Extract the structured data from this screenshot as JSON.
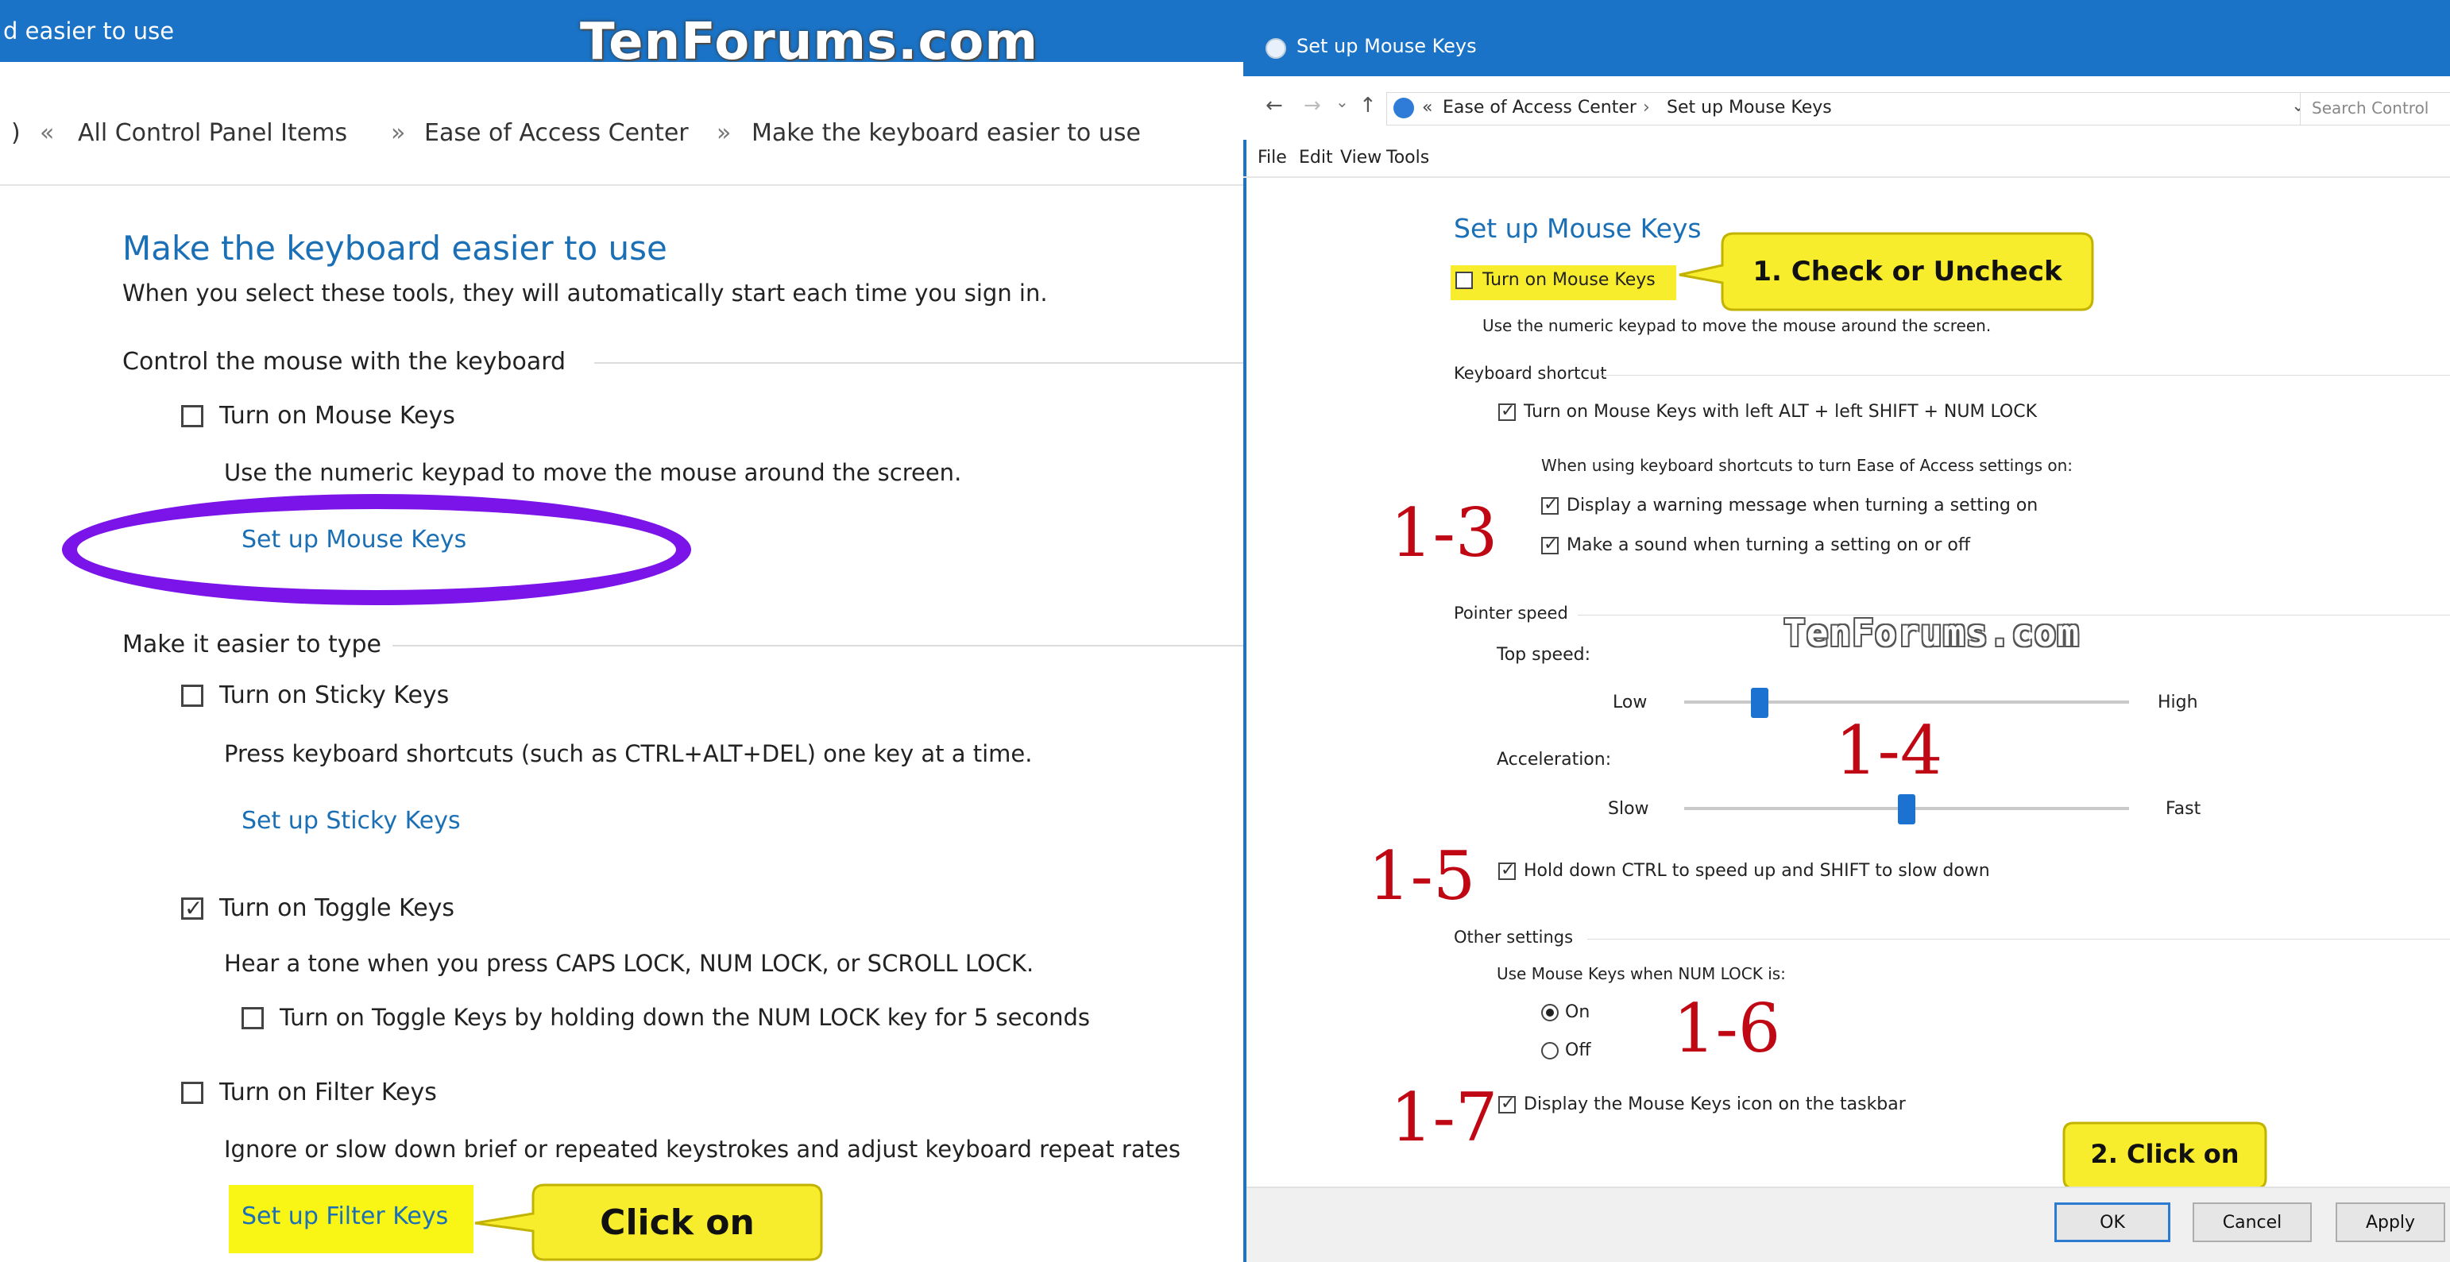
{
  "left_window": {
    "title_fragment": "d easier to use",
    "watermark": "TenForums.com",
    "breadcrumb": {
      "back_glyph": ")",
      "sep0": "«",
      "item1": "All Control Panel Items",
      "sep": "»",
      "item2": "Ease of Access Center",
      "item3": "Make the keyboard easier to use"
    },
    "heading": "Make the keyboard easier to use",
    "subheading": "When you select these tools, they will automatically start each time you sign in.",
    "section_mouse": "Control the mouse with the keyboard",
    "mouse_keys_label": "Turn on Mouse Keys",
    "mouse_keys_checked": false,
    "mouse_keys_desc": "Use the numeric keypad to move the mouse around the screen.",
    "setup_mouse_keys_link": "Set up Mouse Keys",
    "section_type": "Make it easier to type",
    "sticky_label": "Turn on Sticky Keys",
    "sticky_checked": false,
    "sticky_desc": "Press keyboard shortcuts (such as CTRL+ALT+DEL) one key at a time.",
    "setup_sticky_link": "Set up Sticky Keys",
    "toggle_label": "Turn on Toggle Keys",
    "toggle_checked": true,
    "toggle_desc": "Hear a tone when you press CAPS LOCK, NUM LOCK, or SCROLL LOCK.",
    "toggle_hold_label": "Turn on Toggle Keys by holding down the NUM LOCK key for 5 seconds",
    "toggle_hold_checked": false,
    "filter_label": "Turn on Filter Keys",
    "filter_checked": false,
    "filter_desc": "Ignore or slow down brief or repeated keystrokes and adjust keyboard repeat rates",
    "setup_filter_link": "Set up Filter Keys",
    "callout_click_on": "Click on",
    "highlight_color": "#f9f515",
    "ellipse_color": "#7a14e8"
  },
  "dialog": {
    "title": "Set up Mouse Keys",
    "address": {
      "back": "←",
      "forward": "→",
      "recent": "⌄",
      "up": "↑",
      "chev": "«",
      "crumb1": "Ease of Access Center",
      "sep": "›",
      "crumb2": "Set up Mouse Keys",
      "dropdown": "⌄",
      "refresh": "↻",
      "search_placeholder": "Search Control"
    },
    "menu": [
      "File",
      "Edit",
      "View",
      "Tools"
    ],
    "heading": "Set up Mouse Keys",
    "turn_on_label": "Turn on Mouse Keys",
    "turn_on_checked": false,
    "turn_on_desc": "Use the numeric keypad to move the mouse around the screen.",
    "section_shortcut": "Keyboard shortcut",
    "shortcut_label": "Turn on Mouse Keys with left ALT + left SHIFT + NUM LOCK",
    "shortcut_checked": true,
    "shortcut_note": "When using keyboard shortcuts to turn Ease of Access settings on:",
    "warning_label": "Display a warning message when turning a setting on",
    "warning_checked": true,
    "sound_label": "Make a sound when turning a setting on or off",
    "sound_checked": true,
    "section_pointer": "Pointer speed",
    "top_speed_label": "Top speed:",
    "low": "Low",
    "high": "High",
    "top_speed_value": 0.17,
    "accel_label": "Acceleration:",
    "slow": "Slow",
    "fast": "Fast",
    "accel_value": 0.5,
    "ctrl_shift_label": "Hold down CTRL to speed up and SHIFT to slow down",
    "ctrl_shift_checked": true,
    "section_other": "Other settings",
    "numlock_label": "Use Mouse Keys when NUM LOCK is:",
    "radio_on": "On",
    "radio_off": "Off",
    "radio_selected": "On",
    "taskbar_label": "Display the Mouse Keys icon on the taskbar",
    "taskbar_checked": true,
    "ok": "OK",
    "cancel": "Cancel",
    "apply": "Apply",
    "watermark": "TenForums.com"
  },
  "annotations": {
    "callout_check": "1. Check or Uncheck",
    "callout_click": "2. Click on",
    "a13": "1-3",
    "a14": "1-4",
    "a15": "1-5",
    "a16": "1-6",
    "a17": "1-7",
    "annotation_color": "#c00814",
    "callout_color": "#f8ed2d"
  }
}
